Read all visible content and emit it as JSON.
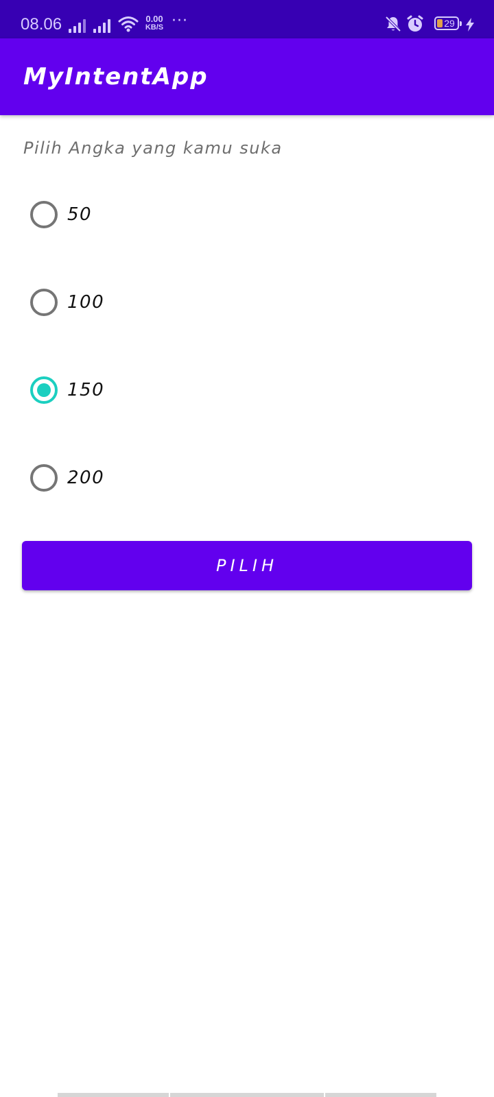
{
  "status_bar": {
    "time": "08.06",
    "net_speed_value": "0.00",
    "net_speed_unit": "KB/S",
    "more_indicator": "···",
    "battery_level": "29",
    "icons": [
      "signal-icon",
      "signal-icon",
      "wifi-icon",
      "bell-muted-icon",
      "alarm-icon",
      "battery-icon",
      "charging-icon"
    ]
  },
  "app_bar": {
    "title": "MyIntentApp"
  },
  "main": {
    "prompt": "Pilih Angka yang kamu suka",
    "options": [
      {
        "label": "50",
        "checked": false
      },
      {
        "label": "100",
        "checked": false
      },
      {
        "label": "150",
        "checked": true
      },
      {
        "label": "200",
        "checked": false
      }
    ],
    "button_label": "PILIH"
  },
  "colors": {
    "status_bar": "#3700B3",
    "primary": "#6200EE",
    "accent": "#1BCFC0",
    "radio_unchecked": "#757575"
  }
}
